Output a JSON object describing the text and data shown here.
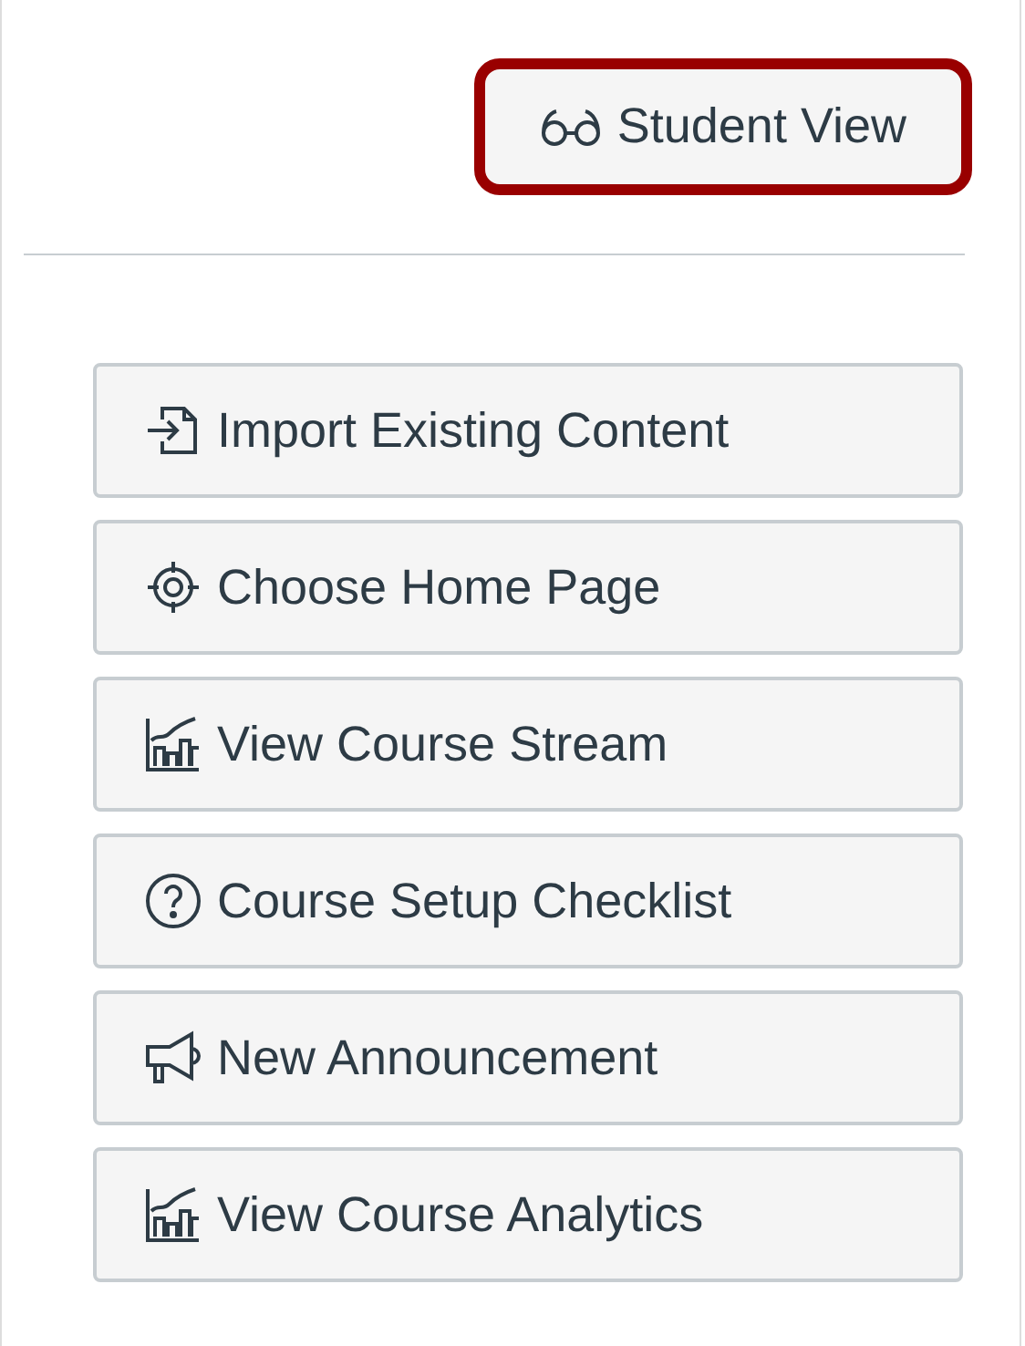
{
  "student_view": {
    "label": "Student View",
    "highlighted": true
  },
  "actions": [
    {
      "label": "Import Existing Content",
      "kind": "import"
    },
    {
      "label": "Choose Home Page",
      "kind": "homepage"
    },
    {
      "label": "View Course Stream",
      "kind": "stream"
    },
    {
      "label": "Course Setup Checklist",
      "kind": "checklist"
    },
    {
      "label": "New Announcement",
      "kind": "announcement"
    },
    {
      "label": "View Course Analytics",
      "kind": "analytics"
    }
  ]
}
